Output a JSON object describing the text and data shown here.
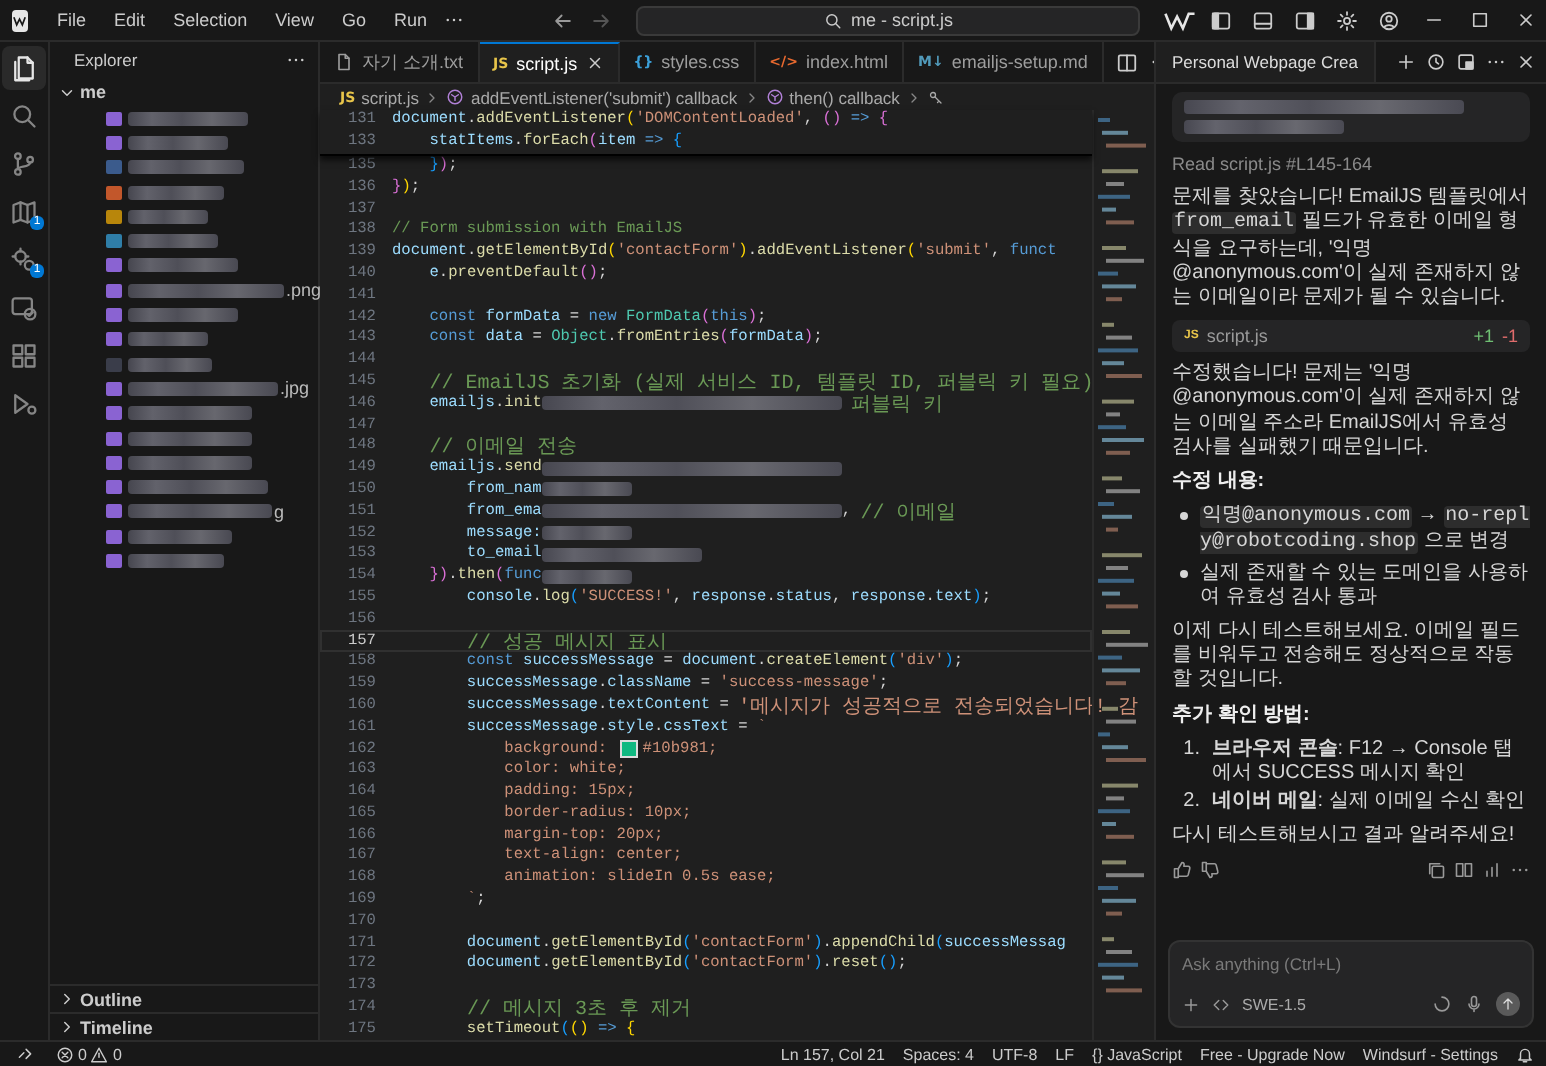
{
  "title_bar": {
    "menu": [
      "File",
      "Edit",
      "Selection",
      "View",
      "Go",
      "Run"
    ],
    "search": "me - script.js"
  },
  "activity_bar": [
    {
      "kind": "files",
      "selected": true
    },
    {
      "kind": "search",
      "selected": false
    },
    {
      "kind": "branch",
      "selected": false
    },
    {
      "kind": "map",
      "selected": false,
      "badge": "1"
    },
    {
      "kind": "gears",
      "selected": false,
      "badge": "1"
    },
    {
      "kind": "screen",
      "selected": false
    },
    {
      "kind": "blocks",
      "selected": false
    },
    {
      "kind": "run",
      "selected": false
    }
  ],
  "explorer": {
    "title": "Explorer",
    "root": {
      "label": "me",
      "expanded": true,
      "children": [
        {
          "color": "#8a63d2"
        },
        {
          "color": "#8a63d2"
        },
        {
          "color": "#3b5b8c"
        },
        {
          "color": "#c2572b"
        },
        {
          "color": "#b8860b"
        },
        {
          "color": "#2f7ea8"
        },
        {
          "color": "#8a63d2"
        },
        {
          "color": "#8a63d2",
          "name_tail": ".png"
        },
        {
          "color": "#8a63d2"
        },
        {
          "color": "#8a63d2"
        },
        {
          "color": "#3a3d4a"
        },
        {
          "color": "#8a63d2",
          "name_tail": ".jpg"
        },
        {
          "color": "#8a63d2"
        },
        {
          "color": "#8a63d2"
        },
        {
          "color": "#8a63d2"
        },
        {
          "color": "#8a63d2"
        },
        {
          "color": "#8a63d2",
          "name_tail": "g"
        },
        {
          "color": "#8a63d2"
        },
        {
          "color": "#8a63d2"
        }
      ]
    },
    "sections": [
      {
        "label": "Outline",
        "expanded": false
      },
      {
        "label": "Timeline",
        "expanded": false
      }
    ]
  },
  "tabs": [
    {
      "label": "자기 소개.txt",
      "kind": "file",
      "selected": false
    },
    {
      "label": "script.js",
      "kind": "badge",
      "badge": "JS",
      "color": "#e8c54a",
      "selected": true
    },
    {
      "label": "styles.css",
      "kind": "badge",
      "badge": "{}",
      "color": "#3b9fd8",
      "selected": false
    },
    {
      "label": "index.html",
      "kind": "badge",
      "badge": "</>",
      "color": "#e8692f",
      "selected": false
    },
    {
      "label": "emailjs-setup.md",
      "kind": "badge",
      "badge": "M↓",
      "color": "#519aba",
      "selected": false
    }
  ],
  "breadcrumb": [
    {
      "kind": "file",
      "badge": "JS",
      "label": "script.js"
    },
    {
      "kind": "symbol",
      "label": "addEventListener('submit') callback"
    },
    {
      "kind": "symbol",
      "label": "then() callback"
    },
    {
      "kind": "key"
    }
  ],
  "editor": {
    "sticky_lines": [
      {
        "n": "131",
        "tokens": [
          {
            "kind": "v",
            "text": "document"
          },
          {
            "kind": "p",
            "text": "."
          },
          {
            "kind": "f",
            "text": "addEventListener"
          },
          {
            "kind": "b1",
            "text": "("
          },
          {
            "kind": "s",
            "text": "'DOMContentLoaded'"
          },
          {
            "kind": "p",
            "text": ", "
          },
          {
            "kind": "b2",
            "text": "()"
          },
          {
            "kind": "k",
            "text": " => "
          },
          {
            "kind": "b2",
            "text": "{"
          }
        ]
      },
      {
        "n": "133",
        "tokens": [
          {
            "kind": "v",
            "text": "    statItems"
          },
          {
            "kind": "p",
            "text": "."
          },
          {
            "kind": "f",
            "text": "forEach"
          },
          {
            "kind": "b2",
            "text": "("
          },
          {
            "kind": "v",
            "text": "item"
          },
          {
            "kind": "k",
            "text": " => "
          },
          {
            "kind": "b3",
            "text": "{"
          }
        ]
      }
    ],
    "lines": [
      {
        "n": "135",
        "current": false,
        "tokens": [
          {
            "kind": "b3",
            "text": "    }"
          },
          {
            "kind": "b2",
            "text": ")"
          },
          {
            "kind": "p",
            "text": ";"
          }
        ]
      },
      {
        "n": "136",
        "current": false,
        "tokens": [
          {
            "kind": "b2",
            "text": "}"
          },
          {
            "kind": "b1",
            "text": ")"
          },
          {
            "kind": "p",
            "text": ";"
          }
        ]
      },
      {
        "n": "137",
        "current": false
      },
      {
        "n": "138",
        "current": false,
        "tokens": [
          {
            "kind": "c",
            "text": "// Form submission with EmailJS"
          }
        ]
      },
      {
        "n": "139",
        "current": false,
        "tokens": [
          {
            "kind": "v",
            "text": "document"
          },
          {
            "kind": "p",
            "text": "."
          },
          {
            "kind": "f",
            "text": "getElementById"
          },
          {
            "kind": "b1",
            "text": "("
          },
          {
            "kind": "s",
            "text": "'contactForm'"
          },
          {
            "kind": "b1",
            "text": ")"
          },
          {
            "kind": "p",
            "text": "."
          },
          {
            "kind": "f",
            "text": "addEventListener"
          },
          {
            "kind": "b1",
            "text": "("
          },
          {
            "kind": "s",
            "text": "'submit'"
          },
          {
            "kind": "p",
            "text": ", "
          },
          {
            "kind": "k",
            "text": "funct"
          }
        ]
      },
      {
        "n": "140",
        "current": false,
        "tokens": [
          {
            "kind": "v",
            "text": "    e"
          },
          {
            "kind": "p",
            "text": "."
          },
          {
            "kind": "f",
            "text": "preventDefault"
          },
          {
            "kind": "b2",
            "text": "()"
          },
          {
            "kind": "p",
            "text": ";"
          }
        ]
      },
      {
        "n": "141",
        "current": false
      },
      {
        "n": "142",
        "current": false,
        "tokens": [
          {
            "kind": "k",
            "text": "    const "
          },
          {
            "kind": "v",
            "text": "formData"
          },
          {
            "kind": "p",
            "text": " = "
          },
          {
            "kind": "k",
            "text": "new "
          },
          {
            "kind": "t",
            "text": "FormData"
          },
          {
            "kind": "b2",
            "text": "("
          },
          {
            "kind": "k",
            "text": "this"
          },
          {
            "kind": "b2",
            "text": ")"
          },
          {
            "kind": "p",
            "text": ";"
          }
        ]
      },
      {
        "n": "143",
        "current": false,
        "tokens": [
          {
            "kind": "k",
            "text": "    const "
          },
          {
            "kind": "v",
            "text": "data"
          },
          {
            "kind": "p",
            "text": " = "
          },
          {
            "kind": "t",
            "text": "Object"
          },
          {
            "kind": "p",
            "text": "."
          },
          {
            "kind": "f",
            "text": "fromEntries"
          },
          {
            "kind": "b2",
            "text": "("
          },
          {
            "kind": "v",
            "text": "formData"
          },
          {
            "kind": "b2",
            "text": ")"
          },
          {
            "kind": "p",
            "text": ";"
          }
        ]
      },
      {
        "n": "144",
        "current": false
      },
      {
        "n": "145",
        "current": false,
        "tokens": [
          {
            "kind": "c",
            "text": "    // EmailJS 초기화 (실제 서비스 ID, 템플릿 ID, 퍼블릭 키 필요)"
          }
        ]
      },
      {
        "n": "146",
        "current": false,
        "tokens": [
          {
            "kind": "v",
            "text": "    emailjs"
          },
          {
            "kind": "p",
            "text": "."
          },
          {
            "kind": "f",
            "text": "init"
          },
          {
            "kind": "r5"
          },
          {
            "kind": "c",
            "text": " 퍼블릭 키"
          }
        ]
      },
      {
        "n": "147",
        "current": false
      },
      {
        "n": "148",
        "current": false,
        "tokens": [
          {
            "kind": "c",
            "text": "    // 이메일 전송"
          }
        ]
      },
      {
        "n": "149",
        "current": false,
        "tokens": [
          {
            "kind": "v",
            "text": "    emailjs"
          },
          {
            "kind": "p",
            "text": "."
          },
          {
            "kind": "f",
            "text": "send"
          },
          {
            "kind": "r5"
          }
        ]
      },
      {
        "n": "150",
        "current": false,
        "tokens": [
          {
            "kind": "v",
            "text": "        from_nam"
          },
          {
            "kind": "r2"
          }
        ]
      },
      {
        "n": "151",
        "current": false,
        "tokens": [
          {
            "kind": "v",
            "text": "        from_ema"
          },
          {
            "kind": "r5"
          },
          {
            "kind": "p",
            "text": ", "
          },
          {
            "kind": "c",
            "text": "// 이메일"
          }
        ]
      },
      {
        "n": "152",
        "current": false,
        "tokens": [
          {
            "kind": "v",
            "text": "        message:"
          },
          {
            "kind": "r2"
          }
        ]
      },
      {
        "n": "153",
        "current": false,
        "tokens": [
          {
            "kind": "v",
            "text": "        to_email"
          },
          {
            "kind": "r3"
          }
        ]
      },
      {
        "n": "154",
        "current": false,
        "tokens": [
          {
            "kind": "b2",
            "text": "    }"
          },
          {
            "kind": "b2",
            "text": ")"
          },
          {
            "kind": "p",
            "text": "."
          },
          {
            "kind": "f",
            "text": "then"
          },
          {
            "kind": "b2",
            "text": "("
          },
          {
            "kind": "k",
            "text": "func"
          },
          {
            "kind": "r2"
          }
        ]
      },
      {
        "n": "155",
        "current": false,
        "tokens": [
          {
            "kind": "v",
            "text": "        console"
          },
          {
            "kind": "p",
            "text": "."
          },
          {
            "kind": "f",
            "text": "log"
          },
          {
            "kind": "b3",
            "text": "("
          },
          {
            "kind": "s",
            "text": "'SUCCESS!'"
          },
          {
            "kind": "p",
            "text": ", "
          },
          {
            "kind": "v",
            "text": "response"
          },
          {
            "kind": "p",
            "text": "."
          },
          {
            "kind": "v",
            "text": "status"
          },
          {
            "kind": "p",
            "text": ", "
          },
          {
            "kind": "v",
            "text": "response"
          },
          {
            "kind": "p",
            "text": "."
          },
          {
            "kind": "v",
            "text": "text"
          },
          {
            "kind": "b3",
            "text": ")"
          },
          {
            "kind": "p",
            "text": ";"
          }
        ]
      },
      {
        "n": "156",
        "current": false
      },
      {
        "n": "157",
        "current": true,
        "tokens": [
          {
            "kind": "c",
            "text": "        // 성공 메시지 표시"
          }
        ]
      },
      {
        "n": "158",
        "current": false,
        "tokens": [
          {
            "kind": "k",
            "text": "        const "
          },
          {
            "kind": "v",
            "text": "successMessage"
          },
          {
            "kind": "p",
            "text": " = "
          },
          {
            "kind": "v",
            "text": "document"
          },
          {
            "kind": "p",
            "text": "."
          },
          {
            "kind": "f",
            "text": "createElement"
          },
          {
            "kind": "b3",
            "text": "("
          },
          {
            "kind": "s",
            "text": "'div'"
          },
          {
            "kind": "b3",
            "text": ")"
          },
          {
            "kind": "p",
            "text": ";"
          }
        ]
      },
      {
        "n": "159",
        "current": false,
        "tokens": [
          {
            "kind": "v",
            "text": "        successMessage"
          },
          {
            "kind": "p",
            "text": "."
          },
          {
            "kind": "v",
            "text": "className"
          },
          {
            "kind": "p",
            "text": " = "
          },
          {
            "kind": "s",
            "text": "'success-message'"
          },
          {
            "kind": "p",
            "text": ";"
          }
        ]
      },
      {
        "n": "160",
        "current": false,
        "tokens": [
          {
            "kind": "v",
            "text": "        successMessage"
          },
          {
            "kind": "p",
            "text": "."
          },
          {
            "kind": "v",
            "text": "textContent"
          },
          {
            "kind": "p",
            "text": " = "
          },
          {
            "kind": "s",
            "text": "'메시지가 성공적으로 전송되었습니다! 감"
          }
        ]
      },
      {
        "n": "161",
        "current": false,
        "tokens": [
          {
            "kind": "v",
            "text": "        successMessage"
          },
          {
            "kind": "p",
            "text": "."
          },
          {
            "kind": "v",
            "text": "style"
          },
          {
            "kind": "p",
            "text": "."
          },
          {
            "kind": "v",
            "text": "cssText"
          },
          {
            "kind": "p",
            "text": " = "
          },
          {
            "kind": "s",
            "text": "`"
          }
        ]
      },
      {
        "n": "162",
        "current": false,
        "tokens": [
          {
            "kind": "s",
            "text": "            background: "
          },
          {
            "kind": "swatch",
            "color": "#10b981"
          },
          {
            "kind": "s",
            "text": "#10b981;"
          }
        ]
      },
      {
        "n": "163",
        "current": false,
        "tokens": [
          {
            "kind": "s",
            "text": "            color: white;"
          }
        ]
      },
      {
        "n": "164",
        "current": false,
        "tokens": [
          {
            "kind": "s",
            "text": "            padding: 15px;"
          }
        ]
      },
      {
        "n": "165",
        "current": false,
        "tokens": [
          {
            "kind": "s",
            "text": "            border-radius: 10px;"
          }
        ]
      },
      {
        "n": "166",
        "current": false,
        "tokens": [
          {
            "kind": "s",
            "text": "            margin-top: 20px;"
          }
        ]
      },
      {
        "n": "167",
        "current": false,
        "tokens": [
          {
            "kind": "s",
            "text": "            text-align: center;"
          }
        ]
      },
      {
        "n": "168",
        "current": false,
        "tokens": [
          {
            "kind": "s",
            "text": "            animation: slideIn 0.5s ease;"
          }
        ]
      },
      {
        "n": "169",
        "current": false,
        "tokens": [
          {
            "kind": "s",
            "text": "        `"
          },
          {
            "kind": "p",
            "text": ";"
          }
        ]
      },
      {
        "n": "170",
        "current": false
      },
      {
        "n": "171",
        "current": false,
        "tokens": [
          {
            "kind": "v",
            "text": "        document"
          },
          {
            "kind": "p",
            "text": "."
          },
          {
            "kind": "f",
            "text": "getElementById"
          },
          {
            "kind": "b3",
            "text": "("
          },
          {
            "kind": "s",
            "text": "'contactForm'"
          },
          {
            "kind": "b3",
            "text": ")"
          },
          {
            "kind": "p",
            "text": "."
          },
          {
            "kind": "f",
            "text": "appendChild"
          },
          {
            "kind": "b3",
            "text": "("
          },
          {
            "kind": "v",
            "text": "successMessag"
          }
        ]
      },
      {
        "n": "172",
        "current": false,
        "tokens": [
          {
            "kind": "v",
            "text": "        document"
          },
          {
            "kind": "p",
            "text": "."
          },
          {
            "kind": "f",
            "text": "getElementById"
          },
          {
            "kind": "b3",
            "text": "("
          },
          {
            "kind": "s",
            "text": "'contactForm'"
          },
          {
            "kind": "b3",
            "text": ")"
          },
          {
            "kind": "p",
            "text": "."
          },
          {
            "kind": "f",
            "text": "reset"
          },
          {
            "kind": "b3",
            "text": "()"
          },
          {
            "kind": "p",
            "text": ";"
          }
        ]
      },
      {
        "n": "173",
        "current": false
      },
      {
        "n": "174",
        "current": false,
        "tokens": [
          {
            "kind": "c",
            "text": "        // 메시지 3초 후 제거"
          }
        ]
      },
      {
        "n": "175",
        "current": false,
        "tokens": [
          {
            "kind": "f",
            "text": "        setTimeout"
          },
          {
            "kind": "b3",
            "text": "("
          },
          {
            "kind": "b1",
            "text": "()"
          },
          {
            "kind": "k",
            "text": " => "
          },
          {
            "kind": "b1",
            "text": "{"
          }
        ]
      }
    ]
  },
  "chat": {
    "tab": "Personal Webpage Crea",
    "blocks": [
      {
        "kind": "redacted_bubble"
      },
      {
        "kind": "tool",
        "text": "Read script.js #L145-164"
      },
      {
        "kind": "paragraph",
        "segments": [
          {
            "kind": "text",
            "text": "문제를 찾았습니다! EmailJS 템플릿에서 "
          },
          {
            "kind": "code",
            "text": "from_email"
          },
          {
            "kind": "text",
            "text": " 필드가 유효한 이메일 형식을 요구하는데, '익명@anonymous.com'이 실제 존재하지 않는 이메일이라 문제가 될 수 있습니다."
          }
        ]
      },
      {
        "kind": "file_change",
        "badge": "JS",
        "name": "script.js",
        "added": "+1",
        "removed": "-1"
      },
      {
        "kind": "paragraph",
        "segments": [
          {
            "kind": "text",
            "text": "수정했습니다! 문제는 '익명@anonymous.com'이 실제 존재하지 않는 이메일 주소라 EmailJS에서 유효성 검사를 실패했기 때문입니다."
          }
        ]
      },
      {
        "kind": "heading",
        "text": "수정 내용:"
      },
      {
        "kind": "bullets",
        "items": [
          {
            "segments": [
              {
                "kind": "code",
                "text": "익명@anonymous.com"
              },
              {
                "kind": "text",
                "text": " → "
              },
              {
                "kind": "code",
                "text": "no-reply@robotcoding.shop"
              },
              {
                "kind": "text",
                "text": " 으로 변경"
              }
            ]
          },
          {
            "segments": [
              {
                "kind": "text",
                "text": "실제 존재할 수 있는 도메인을 사용하여 유효성 검사 통과"
              }
            ]
          }
        ]
      },
      {
        "kind": "paragraph",
        "segments": [
          {
            "kind": "text",
            "text": "이제 다시 테스트해보세요. 이메일 필드를 비워두고 전송해도 정상적으로 작동할 것입니다."
          }
        ]
      },
      {
        "kind": "heading",
        "text": "추가 확인 방법:"
      },
      {
        "kind": "numbered",
        "items": [
          {
            "number": "1.",
            "text": "**브라우저 콘솔**: F12 → Console 탭에서 SUCCESS 메시지 확인"
          },
          {
            "number": "2.",
            "text": "**네이버 메일**: 실제 이메일 수신 확인"
          }
        ]
      },
      {
        "kind": "paragraph",
        "segments": [
          {
            "kind": "text",
            "text": "다시 테스트해보시고 결과 알려주세요!"
          }
        ]
      },
      {
        "kind": "feedback"
      }
    ],
    "input": {
      "placeholder": "Ask anything (Ctrl+L)",
      "model": "SWE-1.5"
    }
  },
  "status_bar": {
    "errors": "0",
    "warnings": "0",
    "items": [
      "Ln 157, Col 21",
      "Spaces: 4",
      "UTF-8",
      "LF",
      "{} JavaScript",
      "Free - Upgrade Now",
      "Windsurf - Settings"
    ]
  }
}
